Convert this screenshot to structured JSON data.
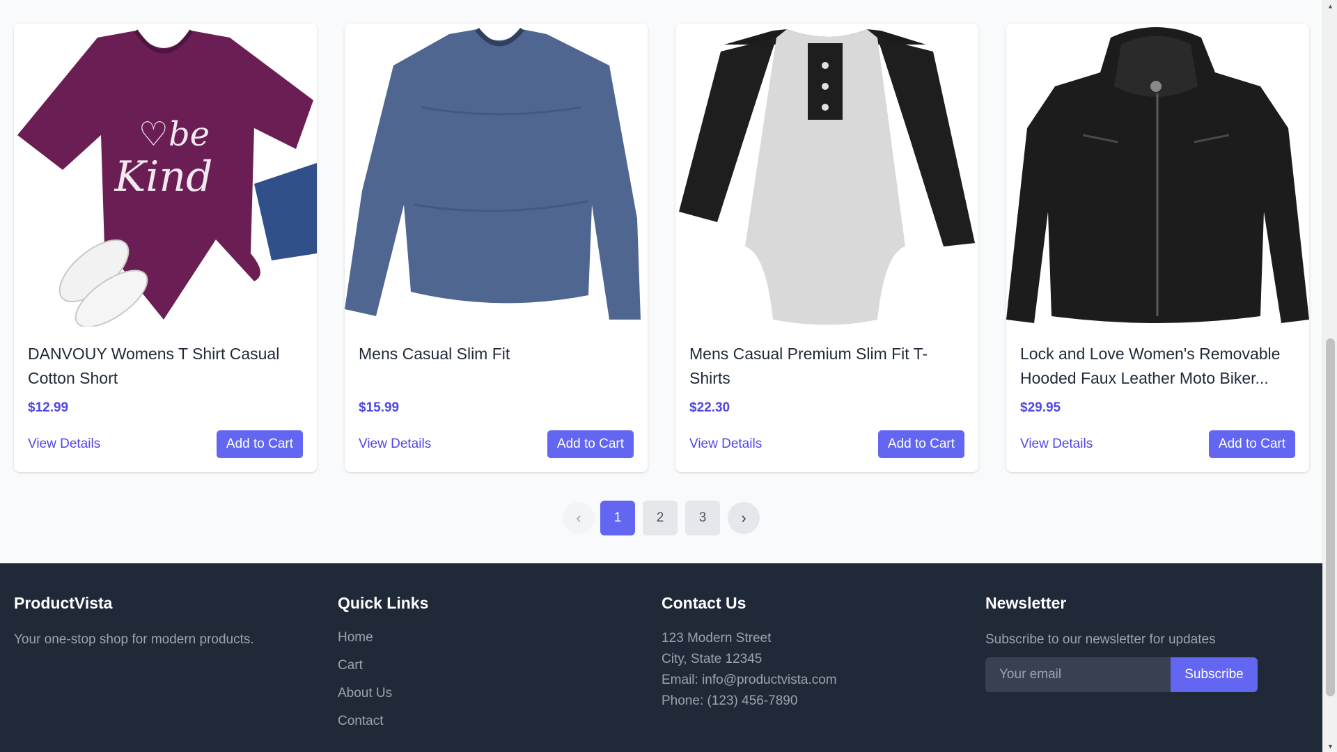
{
  "products": [
    {
      "title": "DANVOUY Womens T Shirt Casual Cotton Short",
      "price": "$12.99",
      "details_label": "View Details",
      "cart_label": "Add to Cart",
      "image_icon": "purple-tshirt-image",
      "image_color": "#6b1e54"
    },
    {
      "title": "Mens Casual Slim Fit",
      "price": "$15.99",
      "details_label": "View Details",
      "cart_label": "Add to Cart",
      "image_icon": "blue-longsleeve-image",
      "image_color": "#4f6690"
    },
    {
      "title": "Mens Casual Premium Slim Fit T-Shirts",
      "price": "$22.30",
      "details_label": "View Details",
      "cart_label": "Add to Cart",
      "image_icon": "raglan-tshirt-image",
      "image_color": "#d9d9d9"
    },
    {
      "title": "Lock and Love Women's Removable Hooded Faux Leather Moto Biker...",
      "price": "$29.95",
      "details_label": "View Details",
      "cart_label": "Add to Cart",
      "image_icon": "leather-jacket-image",
      "image_color": "#1c1c1c"
    }
  ],
  "pagination": {
    "prev_icon": "chevron-left-icon",
    "next_icon": "chevron-right-icon",
    "pages": [
      "1",
      "2",
      "3"
    ],
    "current": "1"
  },
  "footer": {
    "brand": {
      "title": "ProductVista",
      "tagline": "Your one-stop shop for modern products."
    },
    "quick_links": {
      "title": "Quick Links",
      "items": [
        "Home",
        "Cart",
        "About Us",
        "Contact"
      ]
    },
    "contact": {
      "title": "Contact Us",
      "address_line1": "123 Modern Street",
      "address_line2": "City, State 12345",
      "email": "Email: info@productvista.com",
      "phone": "Phone: (123) 456-7890"
    },
    "newsletter": {
      "title": "Newsletter",
      "description": "Subscribe to our newsletter for updates",
      "placeholder": "Your email",
      "button_label": "Subscribe"
    }
  },
  "colors": {
    "accent": "#6366f1",
    "price": "#4f46e5",
    "footer_bg": "#1f2937"
  }
}
